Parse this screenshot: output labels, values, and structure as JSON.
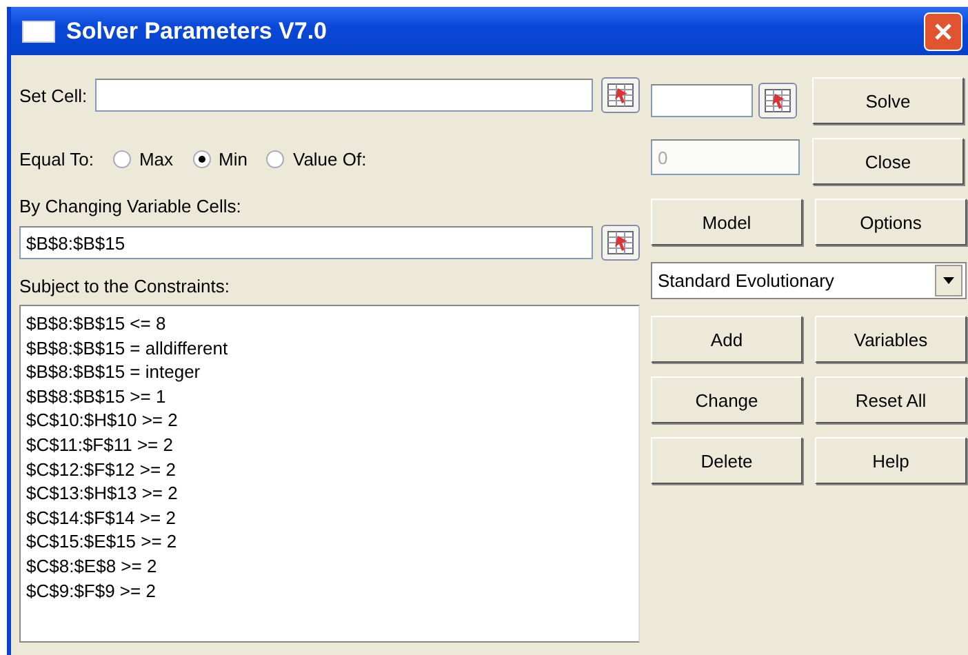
{
  "window": {
    "title": "Solver Parameters V7.0"
  },
  "set_cell": {
    "label": "Set Cell:"
  },
  "equal_to": {
    "label": "Equal To:",
    "options": [
      {
        "label": "Max",
        "selected": false
      },
      {
        "label": "Min",
        "selected": true
      },
      {
        "label": "Value Of:",
        "selected": false
      }
    ]
  },
  "changing_cells": {
    "label": "By Changing Variable Cells:",
    "value": "$B$8:$B$15"
  },
  "constraints": {
    "label": "Subject to the Constraints:",
    "items": [
      "$B$8:$B$15 <= 8",
      "$B$8:$B$15 = alldifferent",
      "$B$8:$B$15 = integer",
      "$B$8:$B$15 >= 1",
      "$C$10:$H$10 >= 2",
      "$C$11:$F$11 >= 2",
      "$C$12:$F$12 >= 2",
      "$C$13:$H$13 >= 2",
      "$C$14:$F$14 >= 2",
      "$C$15:$E$15 >= 2",
      "$C$8:$E$8 >= 2",
      "$C$9:$F$9 >= 2"
    ]
  },
  "value_field": {
    "value": "0",
    "disabled": true
  },
  "buttons": [
    "Solve",
    "Close",
    "Model",
    "Options",
    "Add",
    "Variables",
    "Change",
    "Reset All",
    "Delete",
    "Help"
  ],
  "engine_dropdown": {
    "value": "Standard Evolutionary"
  }
}
